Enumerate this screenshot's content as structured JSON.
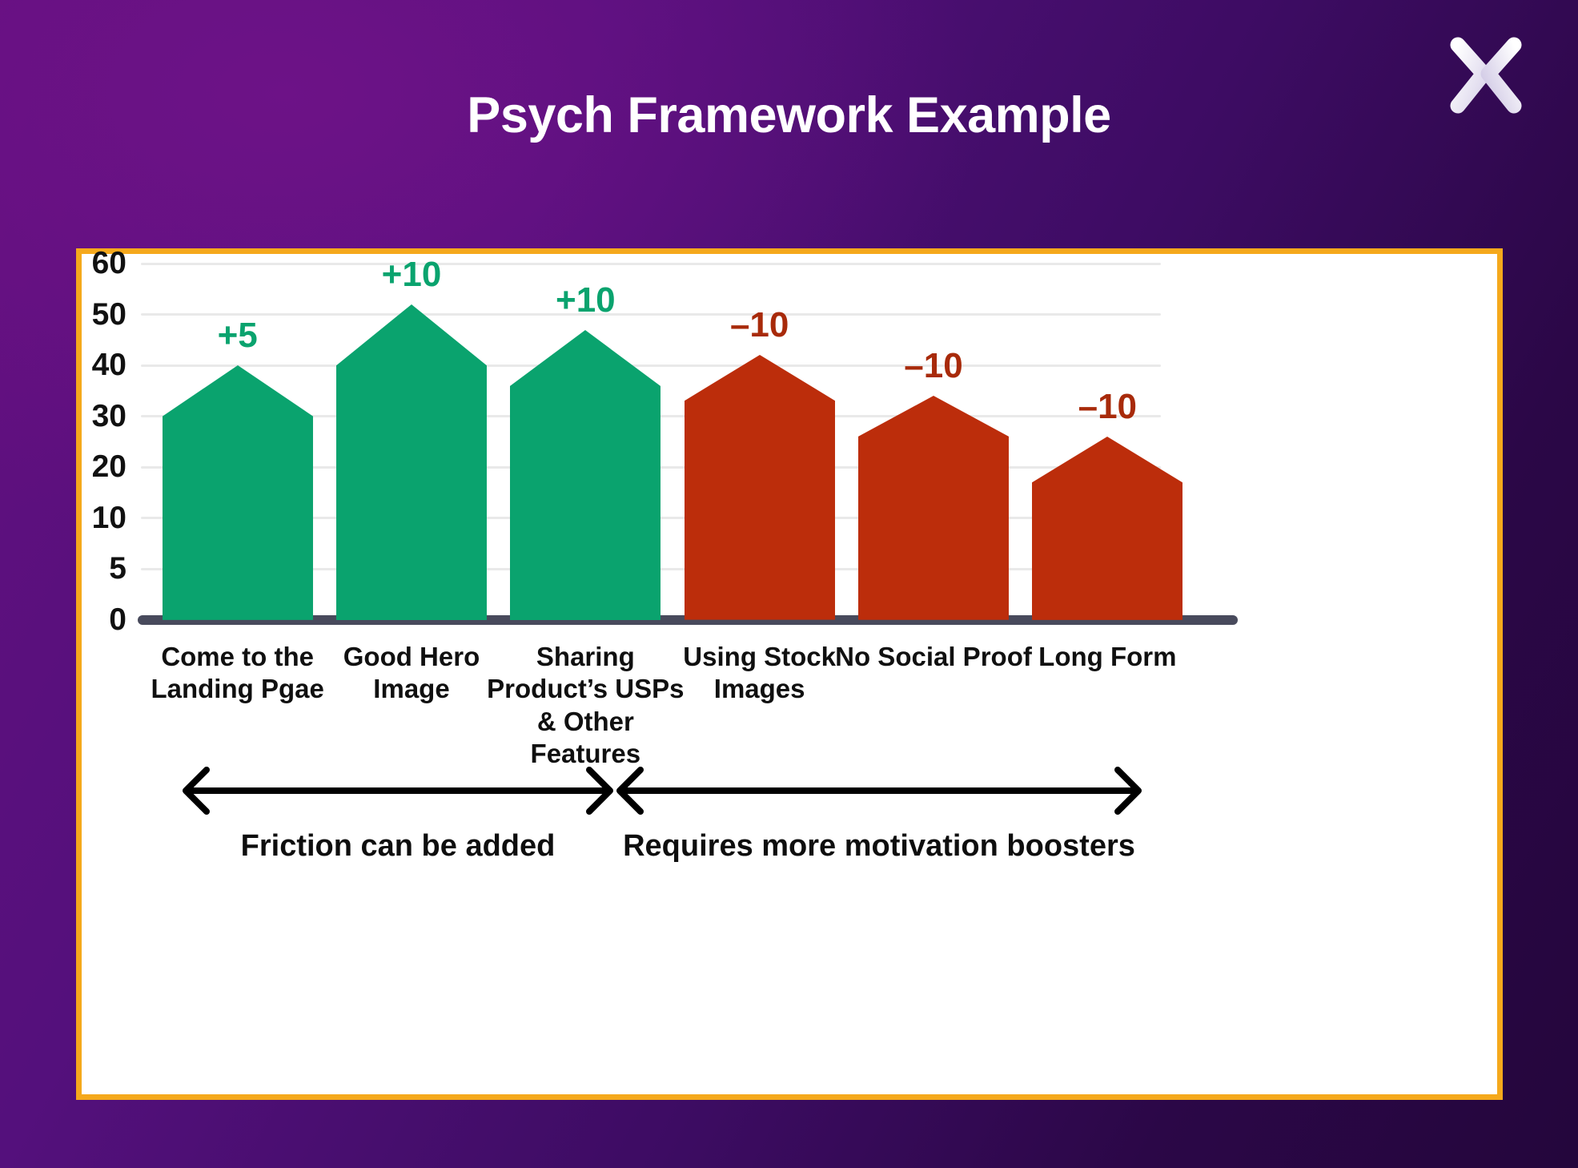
{
  "header": {
    "title": "Psych Framework Example",
    "logo_icon": "x-logo-icon",
    "background_color": "#54107c",
    "title_color": "#ffffff"
  },
  "card": {
    "border_color": "#f5a91c",
    "background_color": "#ffffff"
  },
  "chart_data": {
    "type": "bar",
    "title": "Psych Framework Example",
    "xlabel": "",
    "ylabel": "",
    "ylim": [
      0,
      62
    ],
    "grid": true,
    "legend": "none",
    "ytick_labels": [
      "60",
      "50",
      "40",
      "30",
      "20",
      "10",
      "5",
      "0"
    ],
    "ytick_values": [
      60,
      50,
      40,
      30,
      20,
      10,
      5,
      0
    ],
    "categories": [
      "Come to the Landing Pgae",
      "Good Hero Image",
      "Sharing Product’s USPs & Other Features",
      "Using Stock Images",
      "No Social Proof",
      "Long Form"
    ],
    "values": [
      30,
      40,
      36,
      33,
      26,
      17
    ],
    "peak_values": [
      40,
      52,
      47,
      42,
      34,
      26
    ],
    "data_labels": [
      "+5",
      "+10",
      "+10",
      "–10",
      "–10",
      "–10"
    ],
    "bar_colors": [
      "#0aa36e",
      "#0aa36e",
      "#0aa36e",
      "#bc2d0b",
      "#bc2d0b",
      "#bc2d0b"
    ],
    "label_colors": [
      "#0aa36e",
      "#0aa36e",
      "#0aa36e",
      "#a82a0a",
      "#a82a0a",
      "#a82a0a"
    ],
    "positive_color": "#0aa36e",
    "negative_color": "#bc2d0b",
    "gridline_color": "#e9e9e9",
    "axis_color": "#484a5c"
  },
  "annotations": [
    {
      "text": "Friction can be added",
      "arrow": "double-headed-arrow"
    },
    {
      "text": "Requires more motivation boosters",
      "arrow": "double-headed-arrow"
    }
  ]
}
